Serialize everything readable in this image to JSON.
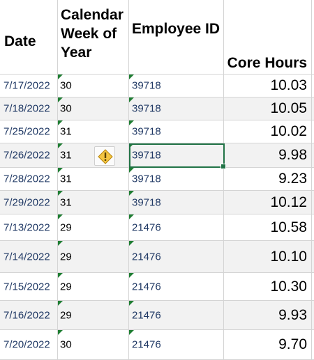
{
  "headers": {
    "date": "Date",
    "week": "Calendar Week of Year",
    "employee": "Employee ID",
    "hours": "Core Hours"
  },
  "rows": [
    {
      "date": "7/17/2022",
      "week": "30",
      "employee": "39718",
      "hours": "10.03"
    },
    {
      "date": "7/18/2022",
      "week": "30",
      "employee": "39718",
      "hours": "10.05"
    },
    {
      "date": "7/25/2022",
      "week": "31",
      "employee": "39718",
      "hours": "10.02"
    },
    {
      "date": "7/26/2022",
      "week": "31",
      "employee": "39718",
      "hours": "9.98"
    },
    {
      "date": "7/28/2022",
      "week": "31",
      "employee": "39718",
      "hours": "9.23"
    },
    {
      "date": "7/29/2022",
      "week": "31",
      "employee": "39718",
      "hours": "10.12"
    },
    {
      "date": "7/13/2022",
      "week": "29",
      "employee": "21476",
      "hours": "10.58"
    },
    {
      "date": "7/14/2022",
      "week": "29",
      "employee": "21476",
      "hours": "10.10"
    },
    {
      "date": "7/15/2022",
      "week": "29",
      "employee": "21476",
      "hours": "10.30"
    },
    {
      "date": "7/16/2022",
      "week": "29",
      "employee": "21476",
      "hours": "9.93"
    },
    {
      "date": "7/20/2022",
      "week": "30",
      "employee": "21476",
      "hours": "9.70"
    }
  ],
  "icons": {
    "error_check": "warning-icon",
    "number_as_text_indicator": "green-triangle"
  },
  "colors": {
    "selection_border": "#217346",
    "text_indicator": "#1e7d32",
    "banded_row": "#f2f2f2",
    "warning_fill": "#f4c542"
  }
}
